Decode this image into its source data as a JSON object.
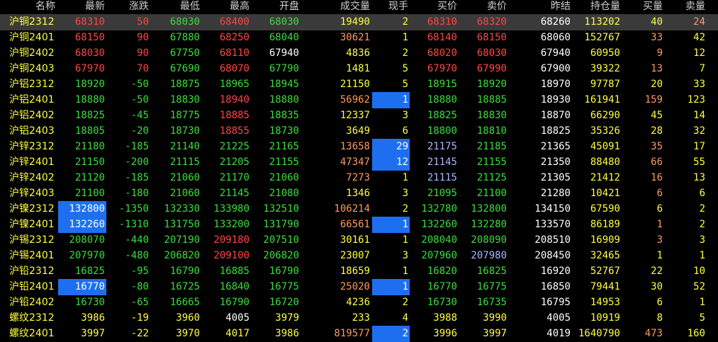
{
  "headers": [
    "名称",
    "最新",
    "涨跌",
    "最低",
    "最高",
    "开盘",
    "成交量",
    "现手",
    "买价",
    "卖价",
    "昨结",
    "持仓量",
    "买量",
    "卖量"
  ],
  "rows": [
    {
      "name": "沪铜2312",
      "last": "68310",
      "chg": "50",
      "low": "68030",
      "high": "68400",
      "open": "68030",
      "vol": "19490",
      "cur": "2",
      "bid": "68310",
      "ask": "68320",
      "settle": "68260",
      "oi": "113202",
      "bq": "40",
      "aq": "24",
      "sel": true,
      "c": [
        "r",
        "r",
        "g",
        "r",
        "g",
        "y",
        "y",
        "r",
        "r",
        "w",
        "y",
        "y",
        "o"
      ]
    },
    {
      "name": "沪铜2401",
      "last": "68150",
      "chg": "90",
      "low": "67880",
      "high": "68250",
      "open": "68040",
      "vol": "30621",
      "cur": "1",
      "bid": "68140",
      "ask": "68150",
      "settle": "68060",
      "oi": "152767",
      "bq": "33",
      "aq": "42",
      "c": [
        "r",
        "r",
        "g",
        "r",
        "g",
        "o",
        "y",
        "r",
        "r",
        "w",
        "y",
        "o",
        "y"
      ]
    },
    {
      "name": "沪铜2402",
      "last": "68030",
      "chg": "90",
      "low": "67750",
      "high": "68110",
      "open": "67940",
      "vol": "4836",
      "cur": "2",
      "bid": "68020",
      "ask": "68030",
      "settle": "67940",
      "oi": "60950",
      "bq": "9",
      "aq": "12",
      "c": [
        "r",
        "r",
        "g",
        "r",
        "w",
        "y",
        "y",
        "r",
        "r",
        "w",
        "y",
        "o",
        "y"
      ]
    },
    {
      "name": "沪铜2403",
      "last": "67970",
      "chg": "70",
      "low": "67690",
      "high": "68070",
      "open": "67790",
      "vol": "1481",
      "cur": "5",
      "bid": "67970",
      "ask": "67990",
      "settle": "67900",
      "oi": "39322",
      "bq": "13",
      "aq": "7",
      "c": [
        "r",
        "r",
        "g",
        "r",
        "g",
        "y",
        "y",
        "r",
        "r",
        "w",
        "y",
        "o",
        "y"
      ]
    },
    {
      "name": "沪铝2312",
      "last": "18920",
      "chg": "-50",
      "low": "18875",
      "high": "18965",
      "open": "18945",
      "vol": "21150",
      "cur": "5",
      "bid": "18915",
      "ask": "18920",
      "settle": "18970",
      "oi": "97787",
      "bq": "20",
      "aq": "33",
      "c": [
        "g",
        "g",
        "g",
        "g",
        "g",
        "y",
        "y",
        "g",
        "g",
        "w",
        "y",
        "y",
        "y"
      ]
    },
    {
      "name": "沪铝2401",
      "last": "18880",
      "chg": "-50",
      "low": "18830",
      "high": "18940",
      "open": "18880",
      "vol": "56962",
      "cur": "1",
      "bid": "18880",
      "ask": "18885",
      "settle": "18930",
      "oi": "161941",
      "bq": "159",
      "aq": "123",
      "hlcur": true,
      "c": [
        "g",
        "g",
        "g",
        "r",
        "g",
        "o",
        "w",
        "g",
        "g",
        "w",
        "y",
        "o",
        "y"
      ]
    },
    {
      "name": "沪铝2402",
      "last": "18825",
      "chg": "-45",
      "low": "18775",
      "high": "18885",
      "open": "18835",
      "vol": "12337",
      "cur": "3",
      "bid": "18825",
      "ask": "18830",
      "settle": "18870",
      "oi": "66290",
      "bq": "45",
      "aq": "14",
      "c": [
        "g",
        "g",
        "g",
        "r",
        "g",
        "y",
        "y",
        "g",
        "g",
        "w",
        "y",
        "y",
        "y"
      ]
    },
    {
      "name": "沪铝2403",
      "last": "18805",
      "chg": "-20",
      "low": "18730",
      "high": "18855",
      "open": "18730",
      "vol": "3649",
      "cur": "6",
      "bid": "18800",
      "ask": "18810",
      "settle": "18825",
      "oi": "35326",
      "bq": "28",
      "aq": "32",
      "c": [
        "g",
        "g",
        "g",
        "r",
        "g",
        "y",
        "y",
        "g",
        "g",
        "w",
        "y",
        "y",
        "y"
      ]
    },
    {
      "name": "沪锌2312",
      "last": "21180",
      "chg": "-185",
      "low": "21140",
      "high": "21225",
      "open": "21165",
      "vol": "13658",
      "cur": "29",
      "bid": "21175",
      "ask": "21185",
      "settle": "21365",
      "oi": "45091",
      "bq": "35",
      "aq": "17",
      "hlcur": true,
      "c": [
        "g",
        "g",
        "g",
        "g",
        "g",
        "o",
        "w",
        "b",
        "g",
        "w",
        "y",
        "o",
        "y"
      ]
    },
    {
      "name": "沪锌2401",
      "last": "21150",
      "chg": "-200",
      "low": "21115",
      "high": "21205",
      "open": "21155",
      "vol": "47347",
      "cur": "12",
      "bid": "21145",
      "ask": "21155",
      "settle": "21350",
      "oi": "88480",
      "bq": "66",
      "aq": "55",
      "hlcur": true,
      "c": [
        "g",
        "g",
        "g",
        "g",
        "g",
        "o",
        "w",
        "b",
        "g",
        "w",
        "y",
        "o",
        "y"
      ]
    },
    {
      "name": "沪锌2402",
      "last": "21120",
      "chg": "-185",
      "low": "21060",
      "high": "21170",
      "open": "21060",
      "vol": "7273",
      "cur": "1",
      "bid": "21115",
      "ask": "21125",
      "settle": "21305",
      "oi": "21412",
      "bq": "16",
      "aq": "13",
      "c": [
        "g",
        "g",
        "g",
        "g",
        "g",
        "o",
        "y",
        "b",
        "g",
        "w",
        "y",
        "o",
        "y"
      ]
    },
    {
      "name": "沪锌2403",
      "last": "21100",
      "chg": "-180",
      "low": "21060",
      "high": "21145",
      "open": "21080",
      "vol": "1346",
      "cur": "3",
      "bid": "21095",
      "ask": "21100",
      "settle": "21280",
      "oi": "10421",
      "bq": "6",
      "aq": "6",
      "c": [
        "g",
        "g",
        "g",
        "g",
        "g",
        "y",
        "y",
        "g",
        "g",
        "w",
        "y",
        "o",
        "y"
      ]
    },
    {
      "name": "沪镍2312",
      "last": "132800",
      "chg": "-1350",
      "low": "132330",
      "high": "133980",
      "open": "132510",
      "vol": "106214",
      "cur": "2",
      "bid": "132780",
      "ask": "132800",
      "settle": "134150",
      "oi": "67590",
      "bq": "6",
      "aq": "2",
      "hllast": true,
      "c": [
        "w",
        "g",
        "g",
        "g",
        "g",
        "o",
        "y",
        "g",
        "g",
        "w",
        "y",
        "y",
        "y"
      ]
    },
    {
      "name": "沪镍2401",
      "last": "132260",
      "chg": "-1310",
      "low": "131750",
      "high": "133200",
      "open": "131790",
      "vol": "66561",
      "cur": "1",
      "bid": "132260",
      "ask": "132280",
      "settle": "133570",
      "oi": "86189",
      "bq": "1",
      "aq": "2",
      "hllast": true,
      "hlcur": true,
      "c": [
        "w",
        "g",
        "g",
        "g",
        "g",
        "o",
        "w",
        "g",
        "g",
        "w",
        "y",
        "o",
        "y"
      ]
    },
    {
      "name": "沪锡2312",
      "last": "208070",
      "chg": "-440",
      "low": "207190",
      "high": "209180",
      "open": "207510",
      "vol": "30161",
      "cur": "1",
      "bid": "208040",
      "ask": "208090",
      "settle": "208510",
      "oi": "16909",
      "bq": "3",
      "aq": "3",
      "c": [
        "g",
        "g",
        "g",
        "r",
        "g",
        "y",
        "y",
        "g",
        "g",
        "w",
        "y",
        "o",
        "y"
      ]
    },
    {
      "name": "沪锡2401",
      "last": "207970",
      "chg": "-480",
      "low": "206820",
      "high": "209100",
      "open": "206820",
      "vol": "23007",
      "cur": "3",
      "bid": "207960",
      "ask": "207980",
      "settle": "208450",
      "oi": "32465",
      "bq": "1",
      "aq": "1",
      "c": [
        "g",
        "g",
        "g",
        "r",
        "g",
        "y",
        "y",
        "g",
        "b",
        "w",
        "y",
        "y",
        "y"
      ]
    },
    {
      "name": "沪铅2312",
      "last": "16825",
      "chg": "-95",
      "low": "16790",
      "high": "16885",
      "open": "16790",
      "vol": "18659",
      "cur": "1",
      "bid": "16820",
      "ask": "16825",
      "settle": "16920",
      "oi": "52767",
      "bq": "22",
      "aq": "10",
      "c": [
        "g",
        "g",
        "g",
        "g",
        "g",
        "y",
        "y",
        "g",
        "g",
        "w",
        "y",
        "y",
        "y"
      ]
    },
    {
      "name": "沪铅2401",
      "last": "16770",
      "chg": "-80",
      "low": "16725",
      "high": "16840",
      "open": "16775",
      "vol": "25020",
      "cur": "1",
      "bid": "16770",
      "ask": "16775",
      "settle": "16850",
      "oi": "79441",
      "bq": "30",
      "aq": "52",
      "hllast": true,
      "hlcur": true,
      "c": [
        "w",
        "g",
        "g",
        "g",
        "g",
        "o",
        "w",
        "g",
        "g",
        "w",
        "y",
        "y",
        "y"
      ]
    },
    {
      "name": "沪铅2402",
      "last": "16730",
      "chg": "-65",
      "low": "16665",
      "high": "16790",
      "open": "16720",
      "vol": "4236",
      "cur": "2",
      "bid": "16730",
      "ask": "16735",
      "settle": "16795",
      "oi": "14953",
      "bq": "6",
      "aq": "1",
      "c": [
        "g",
        "g",
        "g",
        "g",
        "g",
        "y",
        "y",
        "g",
        "g",
        "w",
        "y",
        "y",
        "y"
      ]
    },
    {
      "name": "螺纹2312",
      "last": "3986",
      "chg": "-19",
      "low": "3960",
      "high": "4005",
      "open": "3979",
      "vol": "233",
      "cur": "4",
      "bid": "3988",
      "ask": "3990",
      "settle": "4005",
      "oi": "10919",
      "bq": "8",
      "aq": "5",
      "c": [
        "y",
        "y",
        "y",
        "w",
        "y",
        "y",
        "y",
        "y",
        "y",
        "w",
        "y",
        "y",
        "y"
      ]
    },
    {
      "name": "螺纹2401",
      "last": "3997",
      "chg": "-22",
      "low": "3970",
      "high": "4017",
      "open": "3986",
      "vol": "819577",
      "cur": "2",
      "bid": "3996",
      "ask": "3997",
      "settle": "4019",
      "oi": "1640790",
      "bq": "473",
      "aq": "160",
      "hlcur": true,
      "c": [
        "y",
        "y",
        "y",
        "y",
        "y",
        "o",
        "w",
        "y",
        "y",
        "w",
        "y",
        "o",
        "y"
      ]
    }
  ]
}
